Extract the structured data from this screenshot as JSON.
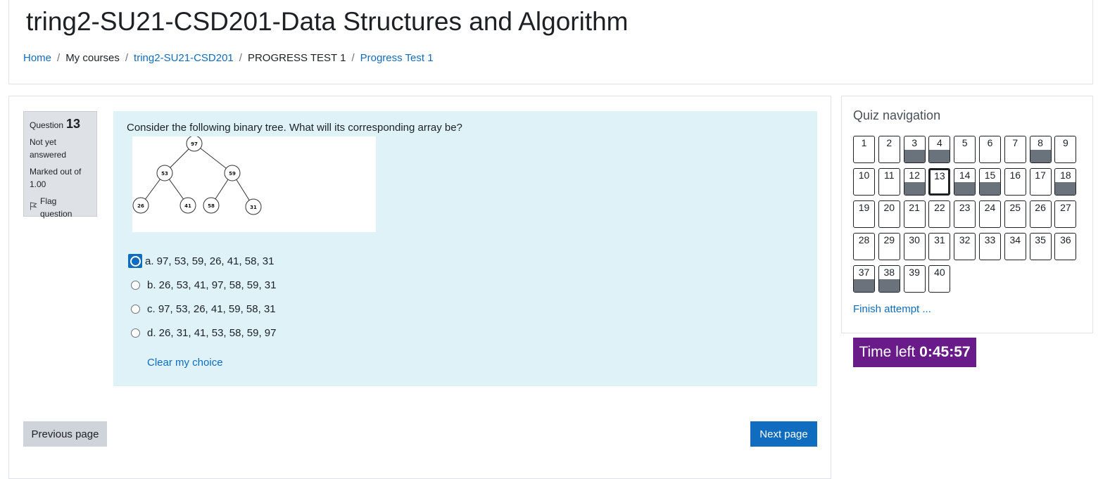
{
  "header": {
    "title": "tring2-SU21-CSD201-Data Structures and Algorithm",
    "breadcrumb": [
      {
        "label": "Home",
        "link": true
      },
      {
        "label": "My courses",
        "link": false
      },
      {
        "label": "tring2-SU21-CSD201",
        "link": true
      },
      {
        "label": "PROGRESS TEST 1",
        "link": false
      },
      {
        "label": "Progress Test 1",
        "link": true
      }
    ],
    "separator": "/"
  },
  "question_info": {
    "label": "Question",
    "number": "13",
    "state": "Not yet answered",
    "grade": "Marked out of 1.00",
    "flag_label": "Flag question"
  },
  "question": {
    "text": "Consider the following binary tree. What will its corresponding array be?",
    "tree_nodes": [
      "97",
      "53",
      "59",
      "26",
      "41",
      "58",
      "31"
    ],
    "answers": [
      {
        "label": "a. 97, 53, 59, 26, 41, 58, 31",
        "focused": true
      },
      {
        "label": "b. 26, 53, 41, 97, 58, 59, 31",
        "focused": false
      },
      {
        "label": "c. 97, 53, 26, 41, 59, 58, 31",
        "focused": false
      },
      {
        "label": "d. 26, 31, 41, 53, 58, 59, 97",
        "focused": false
      }
    ],
    "clear_label": "Clear my choice"
  },
  "buttons": {
    "previous": "Previous page",
    "next": "Next page"
  },
  "quiz_nav": {
    "title": "Quiz navigation",
    "current": 13,
    "answered": [
      3,
      4,
      8,
      12,
      14,
      15,
      18,
      37,
      38
    ],
    "questions": [
      "1",
      "2",
      "3",
      "4",
      "5",
      "6",
      "7",
      "8",
      "9",
      "10",
      "11",
      "12",
      "13",
      "14",
      "15",
      "16",
      "17",
      "18",
      "19",
      "20",
      "21",
      "22",
      "23",
      "24",
      "25",
      "26",
      "27",
      "28",
      "29",
      "30",
      "31",
      "32",
      "33",
      "34",
      "35",
      "36",
      "37",
      "38",
      "39",
      "40"
    ],
    "finish_label": "Finish attempt ..."
  },
  "timer": {
    "label": "Time left",
    "value": "0:45:57",
    "bg_color": "#6a1b8a"
  },
  "colors": {
    "link": "#0f6cbf",
    "question_bg": "#def2f8",
    "info_bg": "#dee2e6"
  }
}
